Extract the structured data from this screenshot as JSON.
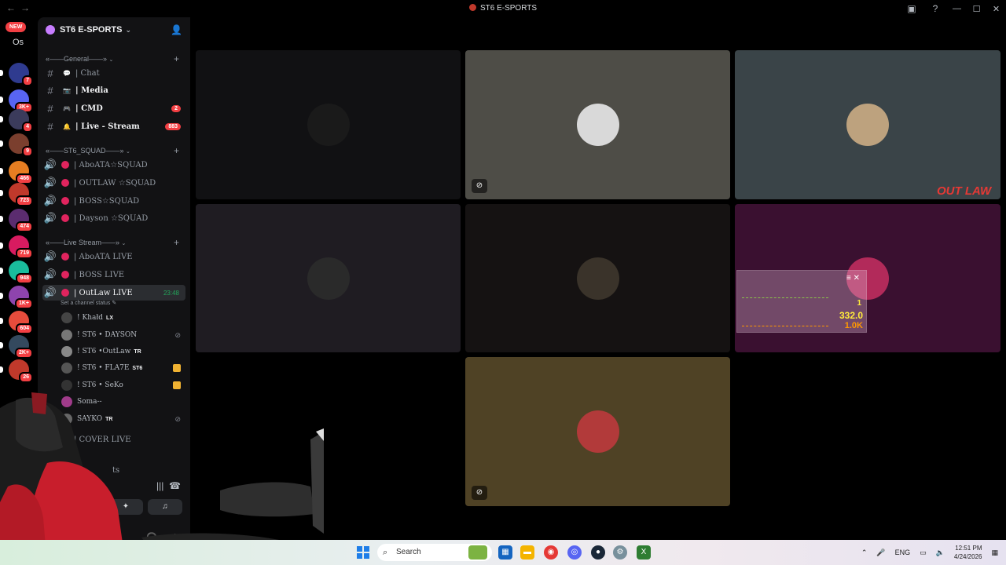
{
  "window": {
    "title": "ST6 E-SPORTS",
    "back_glyph": "←",
    "forward_glyph": "→",
    "controls": [
      "—",
      "☐",
      "✕"
    ]
  },
  "guilds": {
    "new_badge": "NEW",
    "os_label": "Os",
    "items": [
      {
        "color": "#2f3b8f",
        "badge": "7"
      },
      {
        "color": "#5865f2",
        "badge": "3K+"
      },
      {
        "color": "#3b3b5b",
        "badge": "4"
      },
      {
        "color": "#7b3f2e",
        "badge": "9"
      },
      {
        "color": "#e67e22",
        "badge": "466"
      },
      {
        "color": "#c0392b",
        "badge": "723"
      },
      {
        "color": "#5b2c6f",
        "badge": "474"
      },
      {
        "color": "#d81b60",
        "badge": "719"
      },
      {
        "color": "#1abc9c",
        "badge": "948"
      },
      {
        "color": "#8e44ad",
        "badge": "1K+"
      },
      {
        "color": "#e74c3c",
        "badge": "604"
      },
      {
        "color": "#34495e",
        "badge": "2K+"
      },
      {
        "color": "#c0392b",
        "badge": "26"
      }
    ]
  },
  "server": {
    "name": "ST6 E-SPORTS",
    "categories": {
      "general": "«——General——»",
      "squad": "«——ST6_SQUAD——»",
      "live": "«——Live Stream——»"
    },
    "text_channels": [
      {
        "name": "| Chat",
        "emoji": "💬",
        "count": ""
      },
      {
        "name": "| Media",
        "emoji": "📷",
        "count": ""
      },
      {
        "name": "| CMD",
        "emoji": "🎮",
        "count": "2"
      },
      {
        "name": "| Live - Stream",
        "emoji": "🔔",
        "count": "883"
      }
    ],
    "squad_channels": [
      "| AboATA☆SQUAD",
      "| OUTLAW ☆SQUAD",
      "| BOSS☆SQUAD",
      "| Dayson ☆SQUAD"
    ],
    "live_channels": [
      "| AboATA LIVE",
      "| BOSS LIVE"
    ],
    "active_channel": {
      "name": "| OutLaw LIVE",
      "time": "23:48",
      "status": "Set a channel status"
    },
    "members": [
      {
        "name": "! Khałd",
        "tag": "LX",
        "color": "#444"
      },
      {
        "name": "! ST6 • DAYSON",
        "tag": "",
        "color": "#777"
      },
      {
        "name": "! ST6 •OutLaw",
        "tag": "TR",
        "color": "#888"
      },
      {
        "name": "! ST6 • FLA7E",
        "tag": "ST6",
        "color": "#555"
      },
      {
        "name": "! ST6 • SeKo",
        "tag": "",
        "color": "#333"
      },
      {
        "name": "Soma--",
        "tag": "",
        "color": "#a03b8a"
      },
      {
        "name": "SAYKO",
        "tag": "TR",
        "color": "#666"
      }
    ],
    "hidden_channel": "| COVER LIVE"
  },
  "voice_panel": {
    "partial_label": "ts"
  },
  "stage": {
    "tiles": [
      {
        "bg": "#111113",
        "avatar": "#1a1a1a",
        "muted": false
      },
      {
        "bg": "#4e4d47",
        "avatar": "#d9d9d9",
        "muted": true
      },
      {
        "bg": "#3a4448",
        "avatar": "#bda27e",
        "muted": false
      },
      {
        "bg": "#1f1c22",
        "avatar": "#2a2a2a",
        "muted": false
      },
      {
        "bg": "#151212",
        "avatar": "#3a332a",
        "muted": false
      },
      {
        "bg": "#3a1030",
        "avatar": "#b22a5a",
        "muted": false
      },
      {
        "bg": "#4f4225",
        "avatar": "#b23a3a",
        "muted": true
      }
    ],
    "overlay": {
      "v1": "1",
      "v2": "332.0",
      "v3": "1.0K"
    },
    "logo": "OUT LAW"
  },
  "taskbar": {
    "search_placeholder": "Search",
    "lang": "ENG",
    "time": "12:51 PM",
    "date": "4/24/2026"
  }
}
